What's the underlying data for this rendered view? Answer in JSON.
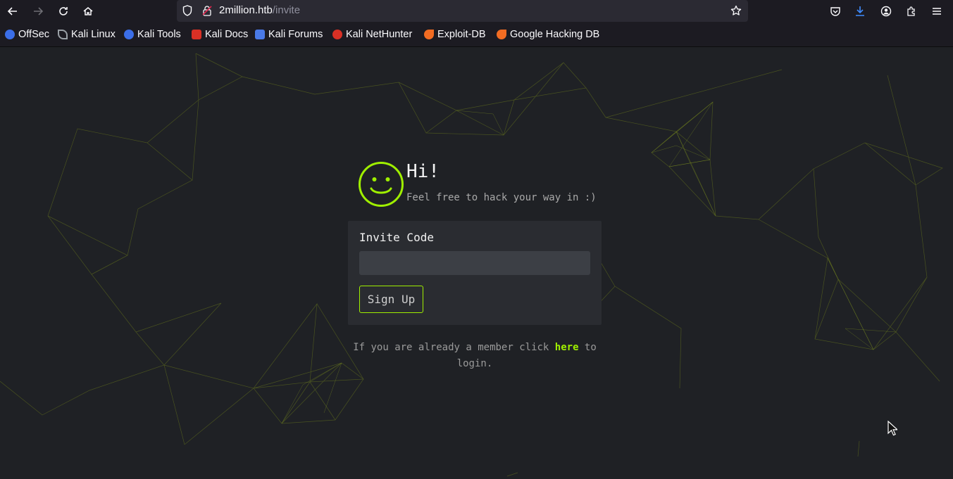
{
  "browser": {
    "url_host": "2million.htb",
    "url_path": "/invite",
    "icons": {
      "back": "back-arrow-icon",
      "forward": "forward-arrow-icon",
      "reload": "reload-icon",
      "home": "home-icon",
      "shield": "tracking-protection-shield-icon",
      "lock": "insecure-lock-icon",
      "bookmark": "bookmark-star-icon",
      "pocket": "pocket-icon",
      "downloads": "download-icon",
      "account": "account-icon",
      "extensions": "extensions-icon",
      "menu": "hamburger-menu-icon"
    }
  },
  "bookmarks": [
    {
      "label": "OffSec",
      "color": "#3b6ee8"
    },
    {
      "label": "Kali Linux",
      "color": "#9aa0a6"
    },
    {
      "label": "Kali Tools",
      "color": "#3b6ee8"
    },
    {
      "label": "Kali Docs",
      "color": "#d93025"
    },
    {
      "label": "Kali Forums",
      "color": "#4a7ae8"
    },
    {
      "label": "Kali NetHunter",
      "color": "#d93025"
    },
    {
      "label": "Exploit-DB",
      "color": "#f26c22"
    },
    {
      "label": "Google Hacking DB",
      "color": "#f26c22"
    }
  ],
  "page": {
    "greeting": "Hi!",
    "subtitle": "Feel free to hack your way in :)",
    "form": {
      "label": "Invite Code",
      "input_value": "",
      "button_label": "Sign Up"
    },
    "member_text_before": "If you are already a member click ",
    "member_link": "here",
    "member_text_after": " to login."
  },
  "colors": {
    "accent": "#9fef00",
    "background": "#1f2125",
    "card": "#2a2c31"
  }
}
